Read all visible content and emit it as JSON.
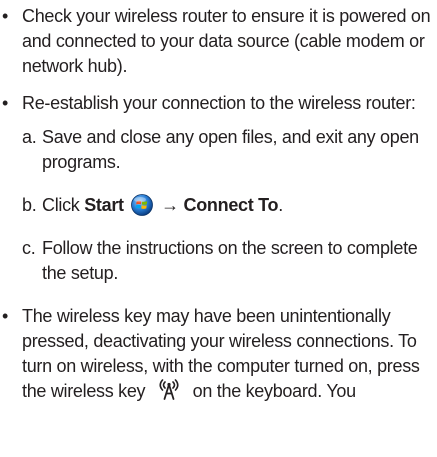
{
  "bullets": [
    {
      "text": "Check your wireless router to ensure it is powered on and connected to your data source (cable modem or network hub)."
    },
    {
      "text": "Re-establish your connection to the wireless router:",
      "steps": [
        {
          "letter": "a.",
          "text": "Save and close any open files, and exit any open programs."
        },
        {
          "letter": "b.",
          "pre": "Click",
          "start_label": "Start",
          "arrow": "→",
          "connect_label": "Connect To",
          "post": "."
        },
        {
          "letter": "c.",
          "text": "Follow the instructions on the screen to complete the setup."
        }
      ]
    },
    {
      "text_before": "The wireless key may have been unintentionally pressed, deactivating your wireless connections. To turn on wireless, with the computer turned on, press the wireless key",
      "text_after": "on the keyboard. You"
    }
  ],
  "bullet_char": "•",
  "icons": {
    "start": "windows-start-orb-icon",
    "wireless": "wireless-key-icon"
  },
  "colors": {
    "text": "#231f20",
    "orb_blue": "#1f6fc5"
  }
}
